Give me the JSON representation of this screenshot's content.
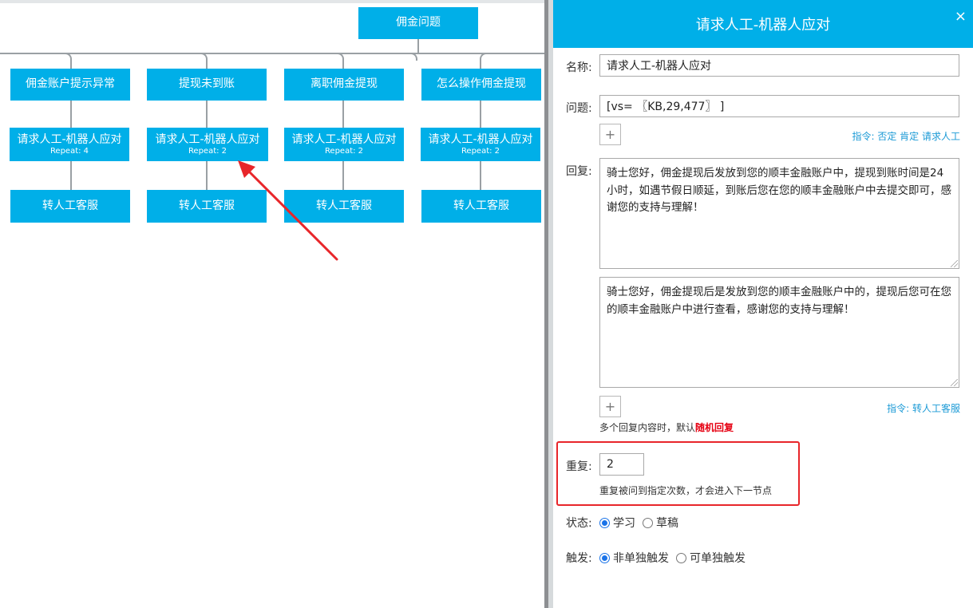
{
  "tree": {
    "root": "佣金问题",
    "columns": [
      {
        "l1": "佣金账户提示异常",
        "l2": "请求人工-机器人应对",
        "l2_sub": "Repeat: 4",
        "l3": "转人工客服"
      },
      {
        "l1": "提现未到账",
        "l2": "请求人工-机器人应对",
        "l2_sub": "Repeat: 2",
        "l3": "转人工客服"
      },
      {
        "l1": "离职佣金提现",
        "l2": "请求人工-机器人应对",
        "l2_sub": "Repeat: 2",
        "l3": "转人工客服"
      },
      {
        "l1": "怎么操作佣金提现",
        "l2": "请求人工-机器人应对",
        "l2_sub": "Repeat: 2",
        "l3": "转人工客服"
      }
    ]
  },
  "panel": {
    "title": "请求人工-机器人应对",
    "close": "×",
    "name_label": "名称:",
    "name_value": "请求人工-机器人应对",
    "question_label": "问题:",
    "question_value": "[vs= 〖KB,29,477〗 ]",
    "add_symbol": "+",
    "question_cmd": "指令: 否定 肯定 请求人工",
    "reply_label": "回复:",
    "reply_1": "骑士您好，佣金提现后发放到您的顺丰金融账户中，提现到账时间是24小时，如遇节假日顺延，到账后您在您的顺丰金融账户中去提交即可，感谢您的支持与理解！",
    "reply_2": "骑士您好，佣金提现后是发放到您的顺丰金融账户中的，提现后您可在您的顺丰金融账户中进行查看，感谢您的支持与理解！",
    "reply_cmd": "指令: 转人工客服",
    "reply_note": "多个回复内容时，默认",
    "reply_note_red": "随机回复",
    "repeat_label": "重复:",
    "repeat_value": "2",
    "repeat_note": "重复被问到指定次数，才会进入下一节点",
    "status_label": "状态:",
    "status_opt1": "学习",
    "status_opt2": "草稿",
    "trigger_label": "触发:",
    "trigger_opt1": "非单独触发",
    "trigger_opt2": "可单独触发"
  },
  "colors": {
    "accent": "#00afe8",
    "annotation": "#e8262a",
    "link": "#1b9ad6"
  }
}
